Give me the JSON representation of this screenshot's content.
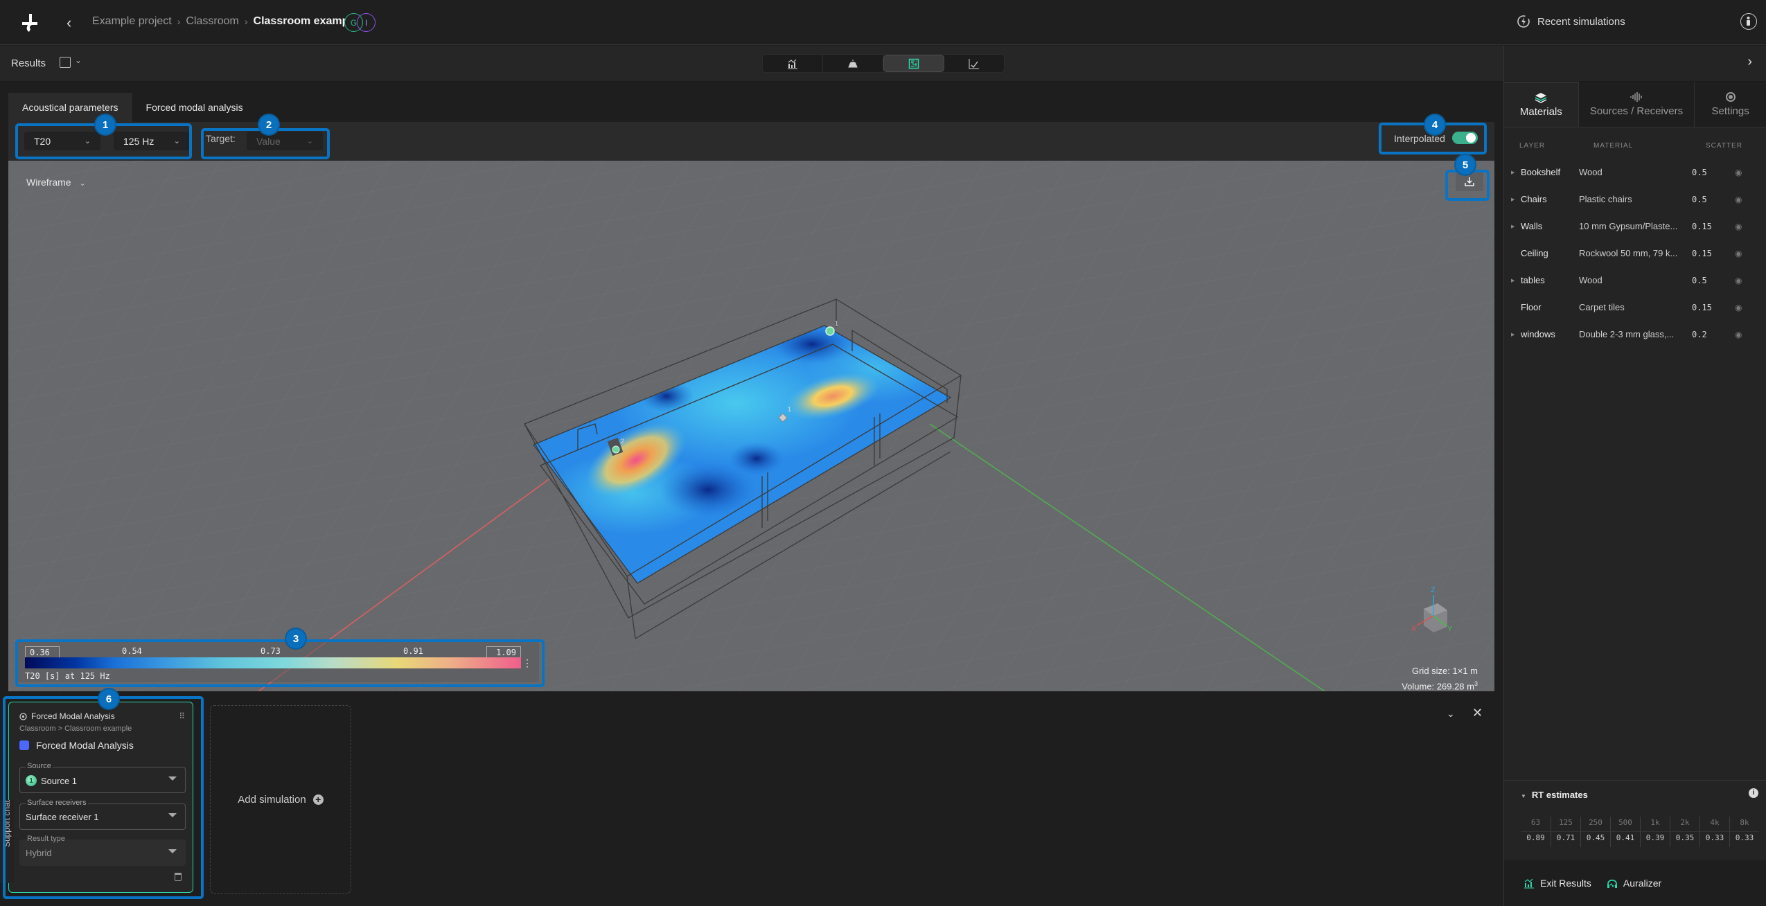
{
  "topbar": {
    "breadcrumbs": [
      "Example project",
      "Classroom",
      "Classroom example"
    ],
    "separator": "›",
    "avatars": [
      "G",
      "I"
    ],
    "recent_simulations": "Recent simulations"
  },
  "subbar": {
    "results_label": "Results",
    "view_modes": [
      "results-chart-icon",
      "source-icon",
      "heatmap-icon",
      "line-chart-icon"
    ],
    "active_view_mode": 2
  },
  "main": {
    "tabs": [
      {
        "label": "Acoustical parameters",
        "active": true
      },
      {
        "label": "Forced modal analysis",
        "active": false
      }
    ],
    "parameter_select": "T20",
    "frequency_select": "125 Hz",
    "target_label": "Target:",
    "target_placeholder": "Value",
    "interpolated_label": "Interpolated",
    "interpolated_on": true,
    "view_mode_select": "Wireframe",
    "legend": {
      "min": "0.36",
      "ticks": [
        "0.54",
        "0.73",
        "0.91"
      ],
      "max": "1.09",
      "caption": "T20 [s] at 125 Hz"
    },
    "grid_size": "Grid size: 1×1 m",
    "volume": "Volume: 269.28 m",
    "volume_unit_sup": "3",
    "axis_labels": {
      "x": "X",
      "y": "Y",
      "z": "Z"
    },
    "markers": [
      {
        "type": "source",
        "label": "1"
      },
      {
        "type": "source",
        "label": "2"
      },
      {
        "type": "receiver",
        "label": "1"
      }
    ]
  },
  "bottom_panel": {
    "card": {
      "title": "Forced Modal Analysis",
      "subtitle": "Classroom > Classroom example",
      "name": "Forced Modal Analysis",
      "color": "#4b67ff",
      "source_label": "Source",
      "source_number": "1",
      "source_value": "Source 1",
      "surface_receivers_label": "Surface receivers",
      "surface_receivers_value": "Surface receiver 1",
      "result_type_label": "Result type",
      "result_type_value": "Hybrid"
    },
    "add_simulation": "Add simulation",
    "support_chat": "Support chat"
  },
  "right_panel": {
    "tabs": [
      {
        "label": "Materials",
        "active": true
      },
      {
        "label": "Sources / Receivers",
        "active": false
      },
      {
        "label": "Settings",
        "active": false
      }
    ],
    "columns": [
      "LAYER",
      "MATERIAL",
      "SCATTER"
    ],
    "materials": [
      {
        "layer": "Bookshelf",
        "material": "Wood",
        "scatter": "0.5",
        "expandable": true
      },
      {
        "layer": "Chairs",
        "material": "Plastic chairs",
        "scatter": "0.5",
        "expandable": true
      },
      {
        "layer": "Walls",
        "material": "10 mm Gypsum/Plaste...",
        "scatter": "0.15",
        "expandable": true
      },
      {
        "layer": "Ceiling",
        "material": "Rockwool 50 mm, 79 k...",
        "scatter": "0.15",
        "expandable": false
      },
      {
        "layer": "tables",
        "material": "Wood",
        "scatter": "0.5",
        "expandable": true
      },
      {
        "layer": "Floor",
        "material": "Carpet tiles",
        "scatter": "0.15",
        "expandable": false
      },
      {
        "layer": "windows",
        "material": "Double 2-3 mm glass,...",
        "scatter": "0.2",
        "expandable": true
      }
    ],
    "rt_estimates": {
      "title": "RT estimates",
      "bands": [
        "63",
        "125",
        "250",
        "500",
        "1k",
        "2k",
        "4k",
        "8k"
      ],
      "values": [
        "0.89",
        "0.71",
        "0.45",
        "0.41",
        "0.39",
        "0.35",
        "0.33",
        "0.33"
      ]
    },
    "exit_results": "Exit Results",
    "auralizer": "Auralizer"
  },
  "annotations": [
    "1",
    "2",
    "3",
    "4",
    "5",
    "6"
  ],
  "colors": {
    "accent": "#2ad6a8",
    "annotation": "#0a74c4",
    "toggle": "#3ab08c"
  }
}
